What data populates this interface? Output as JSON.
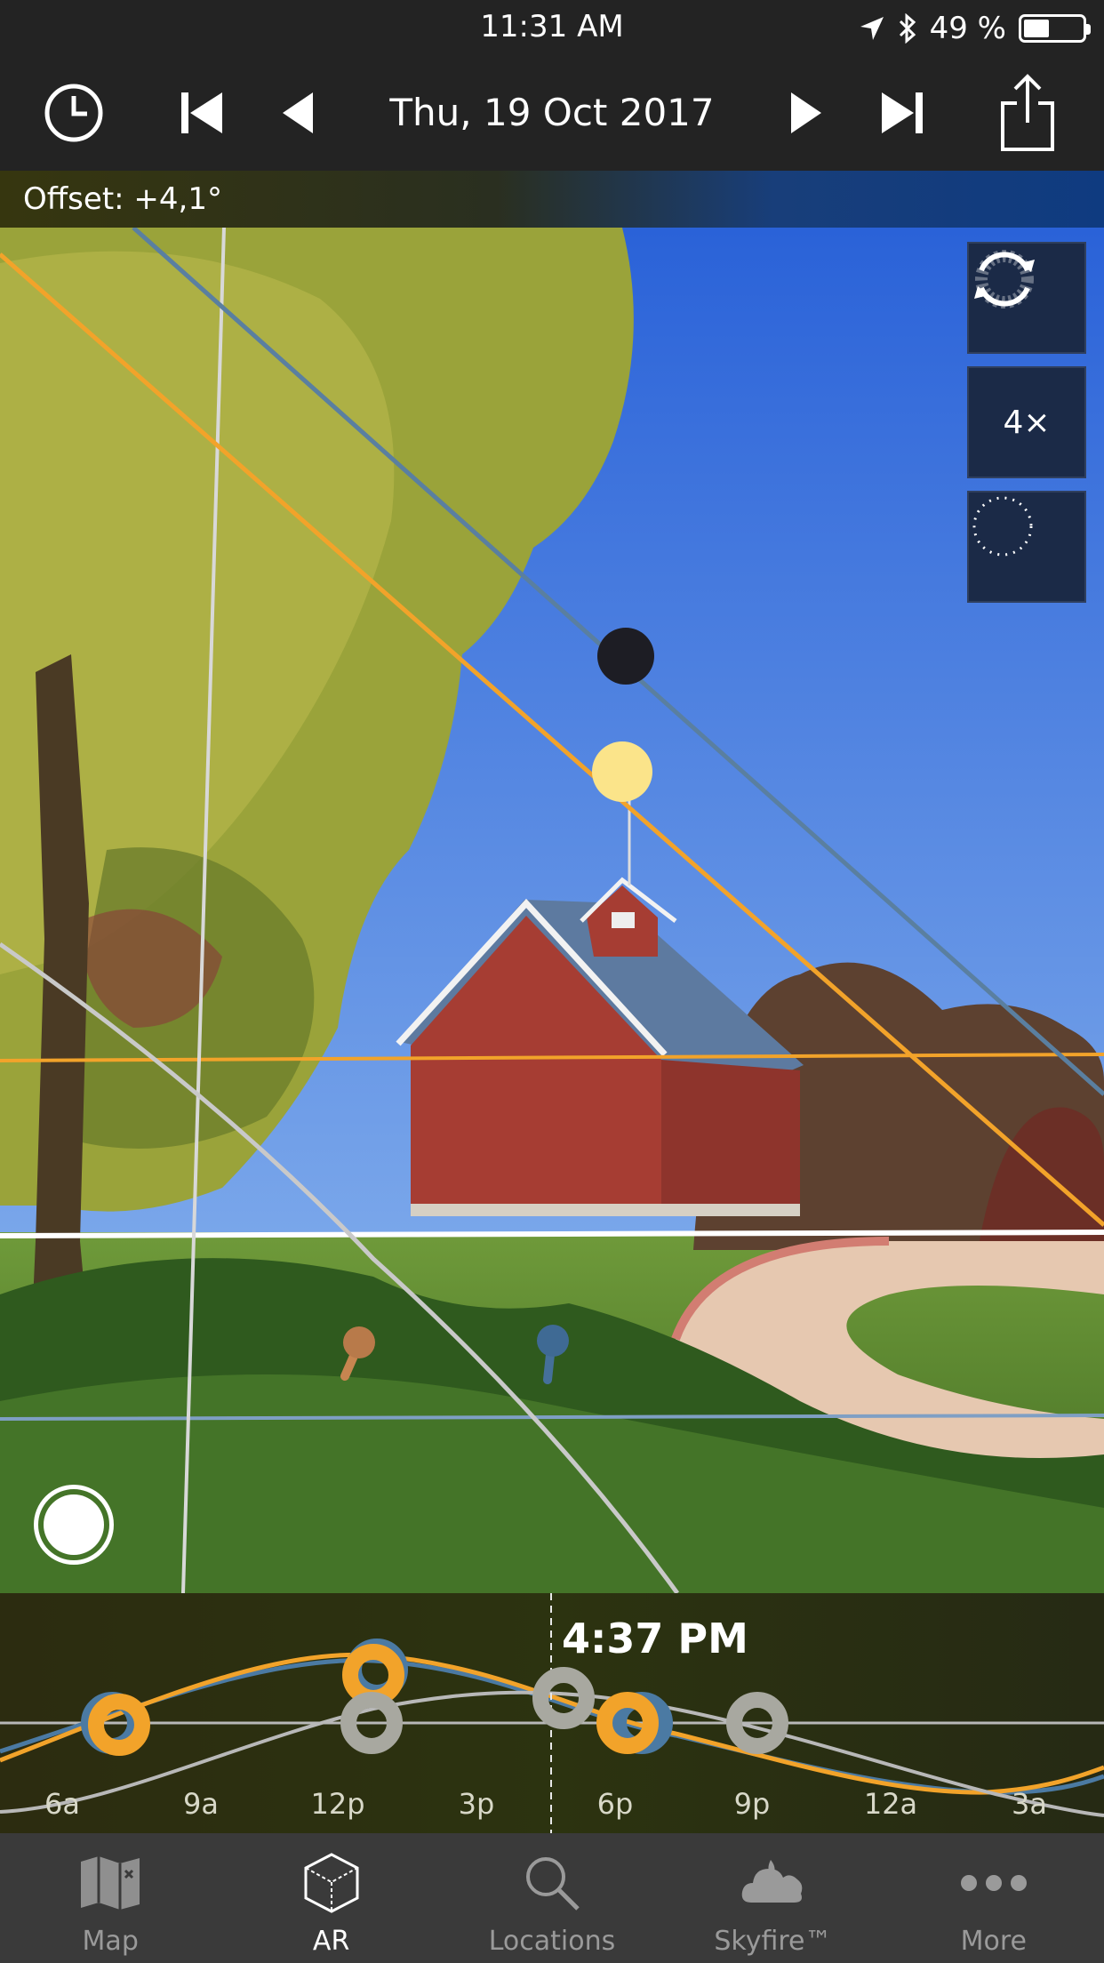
{
  "status": {
    "time": "11:31 AM",
    "battery": "49 %",
    "battery_level": 0.49
  },
  "nav": {
    "date": "Thu, 19 Oct 2017",
    "icons": [
      "clock-icon",
      "skip-back-icon",
      "step-back-icon",
      "step-forward-icon",
      "skip-forward-icon",
      "share-icon"
    ]
  },
  "offset": {
    "text": "Offset: +4,1°"
  },
  "ar": {
    "side_buttons": {
      "reset_icon": "rotate-icon",
      "zoom": "4×",
      "circle_icon": "dotted-circle-icon"
    }
  },
  "timeline": {
    "current_time": "4:37 PM",
    "ticks": [
      "6a",
      "9a",
      "12p",
      "3p",
      "6p",
      "9p",
      "12a",
      "3a"
    ]
  },
  "tabs": [
    {
      "label": "Map",
      "icon": "map-icon",
      "active": false
    },
    {
      "label": "AR",
      "icon": "cube-icon",
      "active": true
    },
    {
      "label": "Locations",
      "icon": "search-icon",
      "active": false
    },
    {
      "label": "Skyfire™",
      "icon": "cloud-icon",
      "active": false
    },
    {
      "label": "More",
      "icon": "more-icon",
      "active": false
    }
  ],
  "colors": {
    "sun": "#f2a32a",
    "moon": "#4b7aa3",
    "grid": "#c8c8c8",
    "bar": "#232323"
  }
}
